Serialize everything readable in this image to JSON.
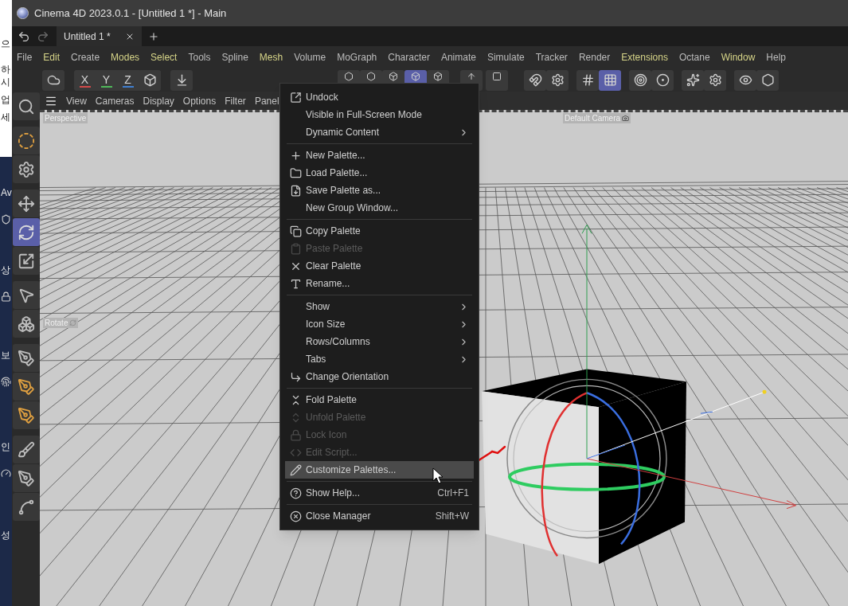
{
  "background_window": {
    "texts": [
      "으",
      "하",
      "시",
      "업",
      "세",
      "Av",
      "상",
      "보",
      "인",
      "성"
    ]
  },
  "window": {
    "title": "Cinema 4D 2023.0.1 - [Untitled 1 *] - Main"
  },
  "tabs": [
    {
      "label": "Untitled 1 *",
      "selected": true
    }
  ],
  "menu_bar": [
    {
      "label": "File",
      "highlighted": false
    },
    {
      "label": "Edit",
      "highlighted": true
    },
    {
      "label": "Create",
      "highlighted": false
    },
    {
      "label": "Modes",
      "highlighted": true
    },
    {
      "label": "Select",
      "highlighted": true
    },
    {
      "label": "Tools",
      "highlighted": false
    },
    {
      "label": "Spline",
      "highlighted": false
    },
    {
      "label": "Mesh",
      "highlighted": true
    },
    {
      "label": "Volume",
      "highlighted": false
    },
    {
      "label": "MoGraph",
      "highlighted": false
    },
    {
      "label": "Character",
      "highlighted": false
    },
    {
      "label": "Animate",
      "highlighted": false
    },
    {
      "label": "Simulate",
      "highlighted": false
    },
    {
      "label": "Tracker",
      "highlighted": false
    },
    {
      "label": "Render",
      "highlighted": false
    },
    {
      "label": "Extensions",
      "highlighted": true
    },
    {
      "label": "Octane",
      "highlighted": false
    },
    {
      "label": "Window",
      "highlighted": true
    },
    {
      "label": "Help",
      "highlighted": false
    }
  ],
  "toolbar": {
    "axis_buttons": [
      {
        "label": "X",
        "color": "#d24a4a"
      },
      {
        "label": "Y",
        "color": "#4fb85a"
      },
      {
        "label": "Z",
        "color": "#3f7fd0"
      }
    ],
    "buttons": [
      {
        "selected": false
      },
      {
        "selected": false
      },
      {
        "selected": false
      },
      {
        "selected": false
      },
      {
        "selected": false
      },
      {
        "selected": false
      },
      {
        "selected": true
      },
      {
        "selected": false
      },
      {
        "selected": false
      },
      {
        "selected": false
      },
      {
        "selected": false
      },
      {
        "selected": false
      },
      {
        "selected": false
      },
      {
        "selected": true
      },
      {
        "selected": false
      },
      {
        "selected": false
      },
      {
        "selected": false
      },
      {
        "selected": false
      },
      {
        "selected": false
      },
      {
        "selected": false
      }
    ]
  },
  "tool_palette": [
    {
      "selected": false
    },
    {
      "selected": false
    },
    {
      "selected": false
    },
    {
      "selected": false
    },
    {
      "selected": true
    },
    {
      "selected": false
    },
    {
      "selected": false
    },
    {
      "selected": false
    },
    {
      "selected": false
    },
    {
      "selected": false
    },
    {
      "selected": false
    },
    {
      "selected": false
    },
    {
      "selected": false
    },
    {
      "selected": false
    }
  ],
  "viewport": {
    "menu": [
      "View",
      "Cameras",
      "Display",
      "Options",
      "Filter",
      "Panel"
    ],
    "view_label": "Perspective",
    "camera_label": "Default Camera",
    "tool_label": "Rotate"
  },
  "context_menu": [
    {
      "kind": "item",
      "label": "Undock",
      "disabled": false,
      "submenu": false,
      "highlighted": false
    },
    {
      "kind": "item",
      "label": "Visible in Full-Screen Mode",
      "disabled": false,
      "submenu": false,
      "highlighted": false
    },
    {
      "kind": "item",
      "label": "Dynamic Content",
      "disabled": false,
      "submenu": true,
      "highlighted": false
    },
    {
      "kind": "separator"
    },
    {
      "kind": "item",
      "label": "New Palette...",
      "disabled": false,
      "submenu": false,
      "highlighted": false
    },
    {
      "kind": "item",
      "label": "Load Palette...",
      "disabled": false,
      "submenu": false,
      "highlighted": false
    },
    {
      "kind": "item",
      "label": "Save Palette as...",
      "disabled": false,
      "submenu": false,
      "highlighted": false
    },
    {
      "kind": "item",
      "label": "New Group Window...",
      "disabled": false,
      "submenu": false,
      "highlighted": false
    },
    {
      "kind": "separator"
    },
    {
      "kind": "item",
      "label": "Copy Palette",
      "disabled": false,
      "submenu": false,
      "highlighted": false
    },
    {
      "kind": "item",
      "label": "Paste Palette",
      "disabled": true,
      "submenu": false,
      "highlighted": false
    },
    {
      "kind": "item",
      "label": "Clear Palette",
      "disabled": false,
      "submenu": false,
      "highlighted": false
    },
    {
      "kind": "item",
      "label": "Rename...",
      "disabled": false,
      "submenu": false,
      "highlighted": false
    },
    {
      "kind": "separator"
    },
    {
      "kind": "item",
      "label": "Show",
      "disabled": false,
      "submenu": true,
      "highlighted": false
    },
    {
      "kind": "item",
      "label": "Icon Size",
      "disabled": false,
      "submenu": true,
      "highlighted": false
    },
    {
      "kind": "item",
      "label": "Rows/Columns",
      "disabled": false,
      "submenu": true,
      "highlighted": false
    },
    {
      "kind": "item",
      "label": "Tabs",
      "disabled": false,
      "submenu": true,
      "highlighted": false
    },
    {
      "kind": "item",
      "label": "Change Orientation",
      "disabled": false,
      "submenu": false,
      "highlighted": false
    },
    {
      "kind": "separator"
    },
    {
      "kind": "item",
      "label": "Fold Palette",
      "disabled": false,
      "submenu": false,
      "highlighted": false
    },
    {
      "kind": "item",
      "label": "Unfold Palette",
      "disabled": true,
      "submenu": false,
      "highlighted": false
    },
    {
      "kind": "item",
      "label": "Lock Icon",
      "disabled": true,
      "submenu": false,
      "highlighted": false
    },
    {
      "kind": "item",
      "label": "Edit Script...",
      "disabled": true,
      "submenu": false,
      "highlighted": false
    },
    {
      "kind": "item",
      "label": "Customize Palettes...",
      "disabled": false,
      "submenu": false,
      "highlighted": true
    },
    {
      "kind": "separator"
    },
    {
      "kind": "item",
      "label": "Show Help...",
      "shortcut": "Ctrl+F1",
      "disabled": false,
      "submenu": false,
      "highlighted": false
    },
    {
      "kind": "separator"
    },
    {
      "kind": "item",
      "label": "Close Manager",
      "shortcut": "Shift+W",
      "disabled": false,
      "submenu": false,
      "highlighted": false
    }
  ]
}
